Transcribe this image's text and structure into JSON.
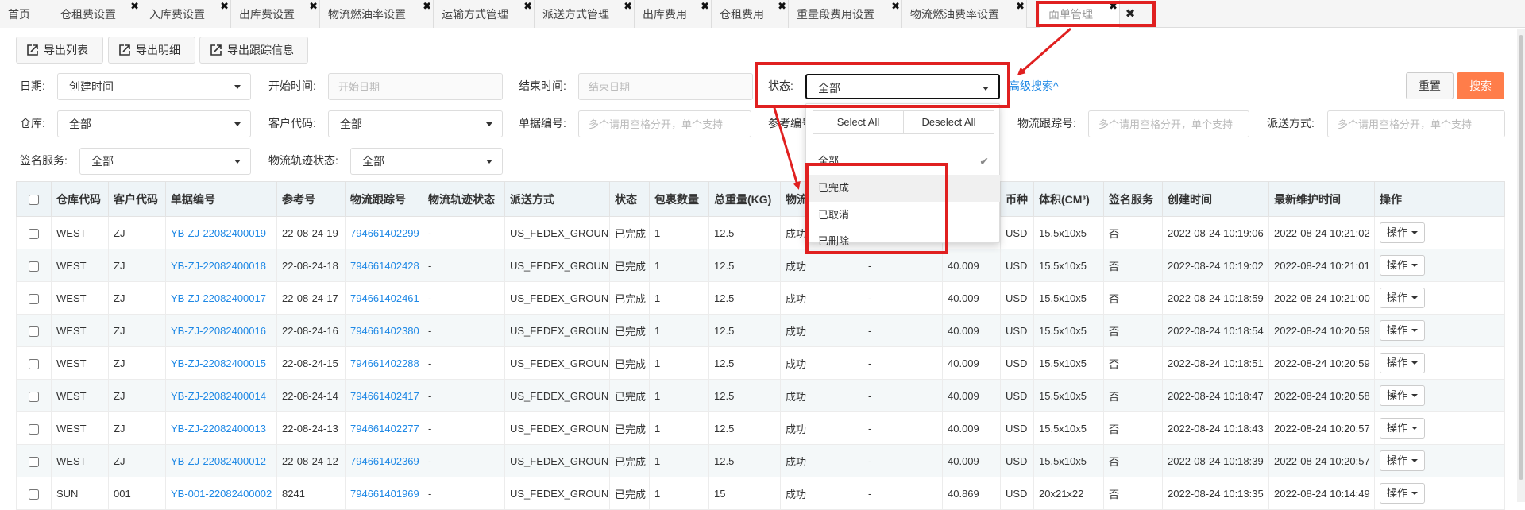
{
  "tabs": [
    {
      "label": "首页",
      "closable": false
    },
    {
      "label": "仓租费设置",
      "closable": true
    },
    {
      "label": "入库费设置",
      "closable": true
    },
    {
      "label": "出库费设置",
      "closable": true
    },
    {
      "label": "物流燃油率设置",
      "closable": true
    },
    {
      "label": "运输方式管理",
      "closable": true
    },
    {
      "label": "派送方式管理",
      "closable": true
    },
    {
      "label": "出库费用",
      "closable": true
    },
    {
      "label": "仓租费用",
      "closable": true
    },
    {
      "label": "重量段费用设置",
      "closable": true
    },
    {
      "label": "物流燃油费率设置",
      "closable": true
    },
    {
      "label": "面单管理",
      "closable": true,
      "active": true
    }
  ],
  "toolbar": {
    "export_list": "导出列表",
    "export_detail": "导出明细",
    "export_tracking": "导出跟踪信息"
  },
  "filters": {
    "date_label": "日期:",
    "date_value": "创建时间",
    "start_label": "开始时间:",
    "start_placeholder": "开始日期",
    "end_label": "结束时间:",
    "end_placeholder": "结束日期",
    "status_label": "状态:",
    "status_value": "全部",
    "advanced": "高级搜索^",
    "reset": "重置",
    "search": "搜索",
    "warehouse_label": "仓库:",
    "warehouse_value": "全部",
    "customer_label": "客户代码:",
    "customer_value": "全部",
    "order_label": "单据编号:",
    "order_placeholder": "多个请用空格分开，单个支持",
    "ref_label": "参考编号",
    "tracking_label": "物流跟踪号:",
    "tracking_placeholder": "多个请用空格分开，单个支持",
    "delivery_label": "派送方式:",
    "delivery_placeholder": "多个请用空格分开，单个支持",
    "sign_label": "签名服务:",
    "sign_value": "全部",
    "track_status_label": "物流轨迹状态:",
    "track_status_value": "全部"
  },
  "status_dropdown": {
    "select_all": "Select All",
    "deselect_all": "Deselect All",
    "options": [
      "全部",
      "已完成",
      "已取消",
      "已删除"
    ],
    "checked": "全部",
    "hovered": "已完成"
  },
  "table": {
    "columns": [
      "仓库代码",
      "客户代码",
      "单据编号",
      "参考号",
      "物流跟踪号",
      "物流轨迹状态",
      "派送方式",
      "状态",
      "包裹数量",
      "总重量(KG)",
      "物流",
      "",
      "",
      "币种",
      "体积(CM³)",
      "签名服务",
      "创建时间",
      "最新维护时间",
      "操作"
    ],
    "op_label": "操作",
    "rows": [
      [
        "WEST",
        "ZJ",
        "YB-ZJ-22082400019",
        "22-08-24-19",
        "794661402299",
        "-",
        "US_FEDEX_GROUND",
        "已完成",
        "1",
        "12.5",
        "成功",
        "",
        "",
        "USD",
        "15.5x10x5",
        "否",
        "2022-08-24 10:19:06",
        "2022-08-24 10:21:02"
      ],
      [
        "WEST",
        "ZJ",
        "YB-ZJ-22082400018",
        "22-08-24-18",
        "794661402428",
        "-",
        "US_FEDEX_GROUND",
        "已完成",
        "1",
        "12.5",
        "成功",
        "-",
        "40.009",
        "USD",
        "15.5x10x5",
        "否",
        "2022-08-24 10:19:02",
        "2022-08-24 10:21:01"
      ],
      [
        "WEST",
        "ZJ",
        "YB-ZJ-22082400017",
        "22-08-24-17",
        "794661402461",
        "-",
        "US_FEDEX_GROUND",
        "已完成",
        "1",
        "12.5",
        "成功",
        "-",
        "40.009",
        "USD",
        "15.5x10x5",
        "否",
        "2022-08-24 10:18:59",
        "2022-08-24 10:21:00"
      ],
      [
        "WEST",
        "ZJ",
        "YB-ZJ-22082400016",
        "22-08-24-16",
        "794661402380",
        "-",
        "US_FEDEX_GROUND",
        "已完成",
        "1",
        "12.5",
        "成功",
        "-",
        "40.009",
        "USD",
        "15.5x10x5",
        "否",
        "2022-08-24 10:18:54",
        "2022-08-24 10:20:59"
      ],
      [
        "WEST",
        "ZJ",
        "YB-ZJ-22082400015",
        "22-08-24-15",
        "794661402288",
        "-",
        "US_FEDEX_GROUND",
        "已完成",
        "1",
        "12.5",
        "成功",
        "-",
        "40.009",
        "USD",
        "15.5x10x5",
        "否",
        "2022-08-24 10:18:51",
        "2022-08-24 10:20:59"
      ],
      [
        "WEST",
        "ZJ",
        "YB-ZJ-22082400014",
        "22-08-24-14",
        "794661402417",
        "-",
        "US_FEDEX_GROUND",
        "已完成",
        "1",
        "12.5",
        "成功",
        "-",
        "40.009",
        "USD",
        "15.5x10x5",
        "否",
        "2022-08-24 10:18:47",
        "2022-08-24 10:20:58"
      ],
      [
        "WEST",
        "ZJ",
        "YB-ZJ-22082400013",
        "22-08-24-13",
        "794661402277",
        "-",
        "US_FEDEX_GROUND",
        "已完成",
        "1",
        "12.5",
        "成功",
        "-",
        "40.009",
        "USD",
        "15.5x10x5",
        "否",
        "2022-08-24 10:18:43",
        "2022-08-24 10:20:57"
      ],
      [
        "WEST",
        "ZJ",
        "YB-ZJ-22082400012",
        "22-08-24-12",
        "794661402369",
        "-",
        "US_FEDEX_GROUND",
        "已完成",
        "1",
        "12.5",
        "成功",
        "-",
        "40.009",
        "USD",
        "15.5x10x5",
        "否",
        "2022-08-24 10:18:39",
        "2022-08-24 10:20:57"
      ],
      [
        "SUN",
        "001",
        "YB-001-22082400002",
        "8241",
        "794661401969",
        "-",
        "US_FEDEX_GROUND",
        "已完成",
        "1",
        "15",
        "成功",
        "-",
        "40.869",
        "USD",
        "20x21x22",
        "否",
        "2022-08-24 10:13:35",
        "2022-08-24 10:14:49"
      ]
    ]
  },
  "colors": {
    "accent": "#ff7d4a",
    "link": "#1e88e5",
    "annotation": "#e02020"
  }
}
